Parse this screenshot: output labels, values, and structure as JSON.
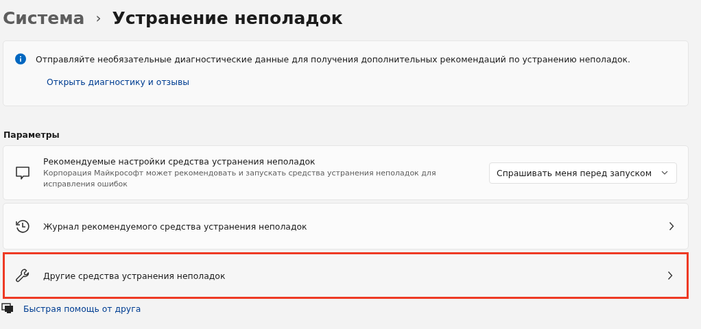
{
  "breadcrumb": {
    "parent": "Система",
    "separator": "›",
    "current": "Устранение неполадок"
  },
  "info_card": {
    "message": "Отправляйте необязательные диагностические данные для получения дополнительных рекомендаций по устранению неполадок.",
    "link": "Открыть диагностику и отзывы"
  },
  "section_title": "Параметры",
  "settings": [
    {
      "kind": "dropdown",
      "title": "Рекомендуемые настройки средства устранения неполадок",
      "description": "Корпорация Майкрософт может рекомендовать и запускать средства устранения неполадок для исправления ошибок",
      "value": "Спрашивать меня перед запуском",
      "highlighted": false
    },
    {
      "kind": "link",
      "title": "Журнал рекомендуемого средства устранения неполадок",
      "highlighted": false
    },
    {
      "kind": "link",
      "title": "Другие средства устранения неполадок",
      "highlighted": true
    }
  ],
  "help_link": "Быстрая помощь от друга"
}
